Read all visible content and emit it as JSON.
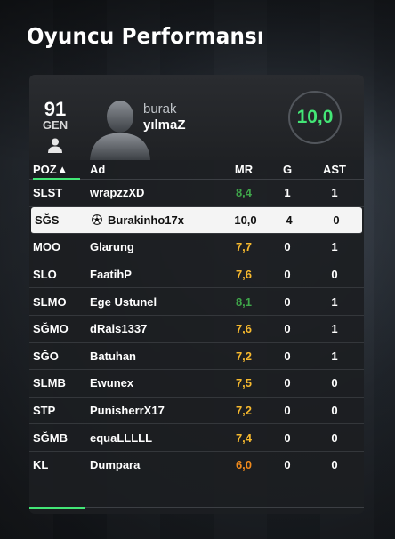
{
  "page_title": "Oyuncu Performansı",
  "player": {
    "rating": "91",
    "position": "GEN",
    "first_name": "burak",
    "last_name": "yılmaZ",
    "match_rating": "10,0"
  },
  "table": {
    "headers": {
      "pos": "POZ▲",
      "name": "Ad",
      "mr": "MR",
      "g": "G",
      "ast": "AST"
    },
    "rows": [
      {
        "pos": "SLST",
        "name": "wrapzzXD",
        "mr": "8,4",
        "g": "1",
        "ast": "1"
      },
      {
        "pos": "SĞS",
        "name": "Burakinho17x",
        "mr": "10,0",
        "g": "4",
        "ast": "0"
      },
      {
        "pos": "MOO",
        "name": "Glarung",
        "mr": "7,7",
        "g": "0",
        "ast": "1"
      },
      {
        "pos": "SLO",
        "name": "FaatihP",
        "mr": "7,6",
        "g": "0",
        "ast": "0"
      },
      {
        "pos": "SLMO",
        "name": "Ege Ustunel",
        "mr": "8,1",
        "g": "0",
        "ast": "1"
      },
      {
        "pos": "SĞMO",
        "name": "dRais1337",
        "mr": "7,6",
        "g": "0",
        "ast": "1"
      },
      {
        "pos": "SĞO",
        "name": "Batuhan",
        "mr": "7,2",
        "g": "0",
        "ast": "1"
      },
      {
        "pos": "SLMB",
        "name": "Ewunex",
        "mr": "7,5",
        "g": "0",
        "ast": "0"
      },
      {
        "pos": "STP",
        "name": "PunisherrX17",
        "mr": "7,2",
        "g": "0",
        "ast": "0"
      },
      {
        "pos": "SĞMB",
        "name": "equaLLLLL",
        "mr": "7,4",
        "g": "0",
        "ast": "0"
      },
      {
        "pos": "KL",
        "name": "Dumpara",
        "mr": "6,0",
        "g": "0",
        "ast": "0"
      }
    ]
  },
  "colors": {
    "accent": "#43e676",
    "mr_high": "#3fa64a",
    "mr_mid": "#f5b82e",
    "mr_low": "#f08a1c",
    "selected_row_bg": "#f4f4f4"
  },
  "icons": {
    "person": "person-icon",
    "ball": "football-icon",
    "silhouette": "player-silhouette-icon"
  }
}
